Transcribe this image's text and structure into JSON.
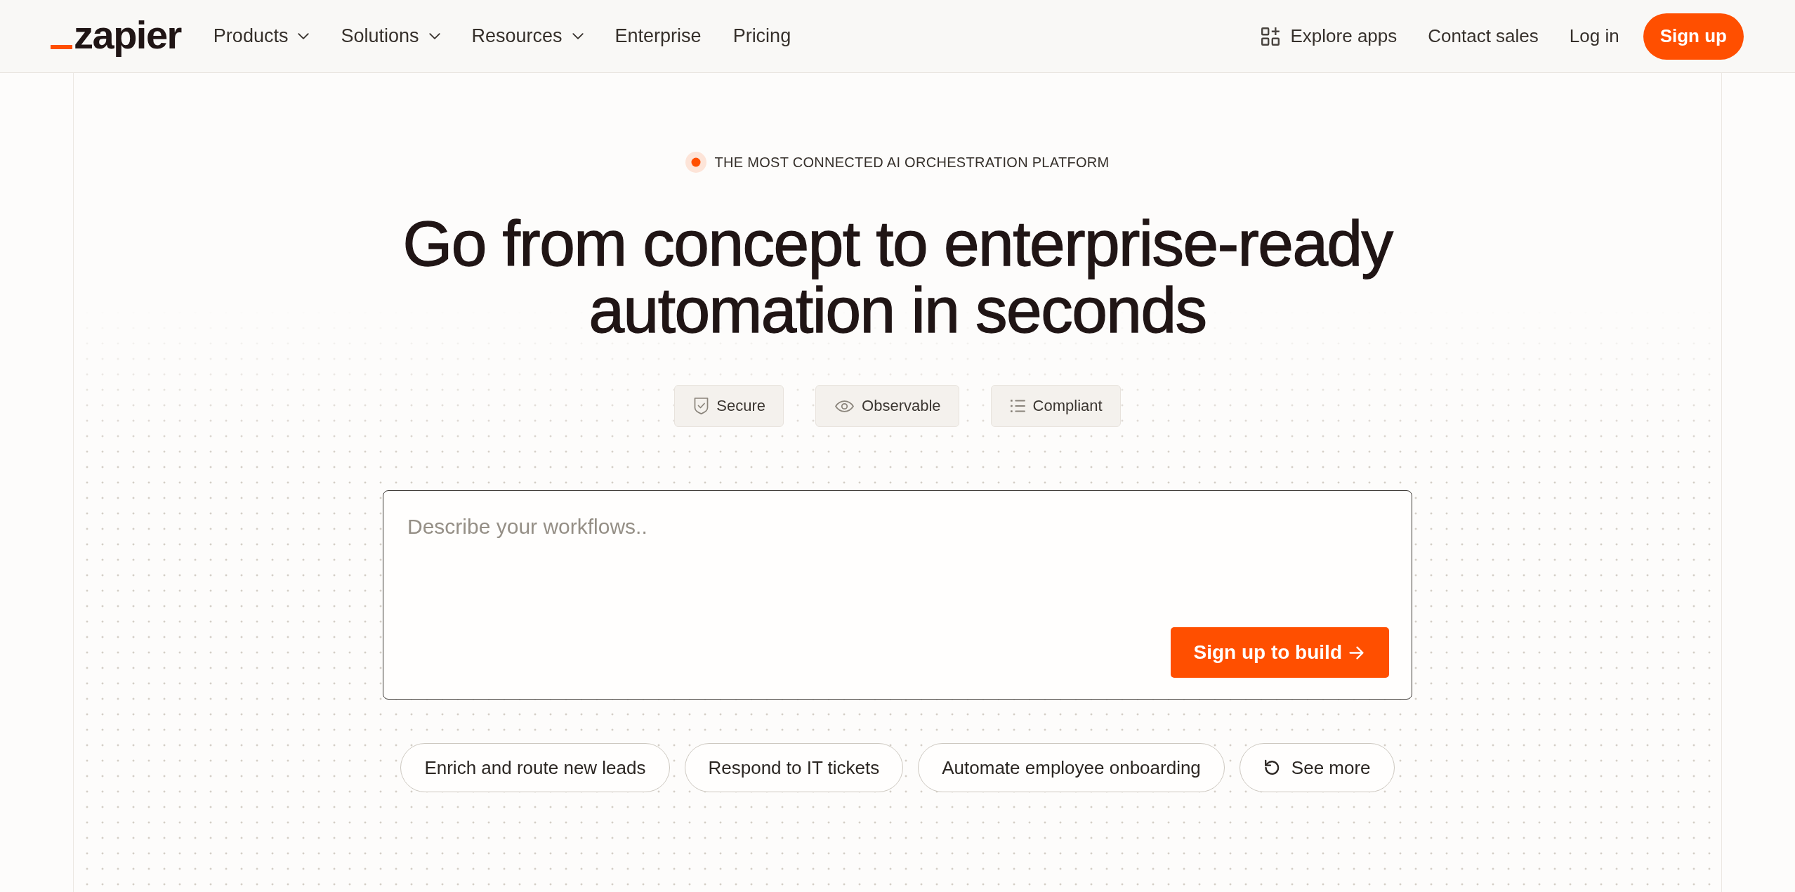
{
  "header": {
    "logo": "zapier",
    "nav": [
      {
        "label": "Products",
        "has_menu": true
      },
      {
        "label": "Solutions",
        "has_menu": true
      },
      {
        "label": "Resources",
        "has_menu": true
      },
      {
        "label": "Enterprise",
        "has_menu": false
      },
      {
        "label": "Pricing",
        "has_menu": false
      }
    ],
    "actions": [
      {
        "kind": "icon-link",
        "label": "Explore apps"
      },
      {
        "kind": "link",
        "label": "Contact sales"
      },
      {
        "kind": "link",
        "label": "Log in"
      },
      {
        "kind": "button",
        "label": "Sign up"
      }
    ]
  },
  "hero": {
    "eyebrow": "THE MOST CONNECTED AI ORCHESTRATION PLATFORM",
    "headline_lines": [
      "Go from concept to enterprise-ready",
      "automation in seconds"
    ],
    "features": [
      {
        "label": "Secure"
      },
      {
        "label": "Observable"
      },
      {
        "label": "Compliant"
      }
    ],
    "prompt": {
      "placeholder": "Describe your workflows..",
      "button": "Sign up to build"
    },
    "suggestions": [
      {
        "kind": "prompt",
        "label": "Enrich and route new leads"
      },
      {
        "kind": "prompt",
        "label": "Respond to IT tickets"
      },
      {
        "kind": "prompt",
        "label": "Automate employee onboarding"
      },
      {
        "kind": "more",
        "label": "See more"
      }
    ]
  }
}
